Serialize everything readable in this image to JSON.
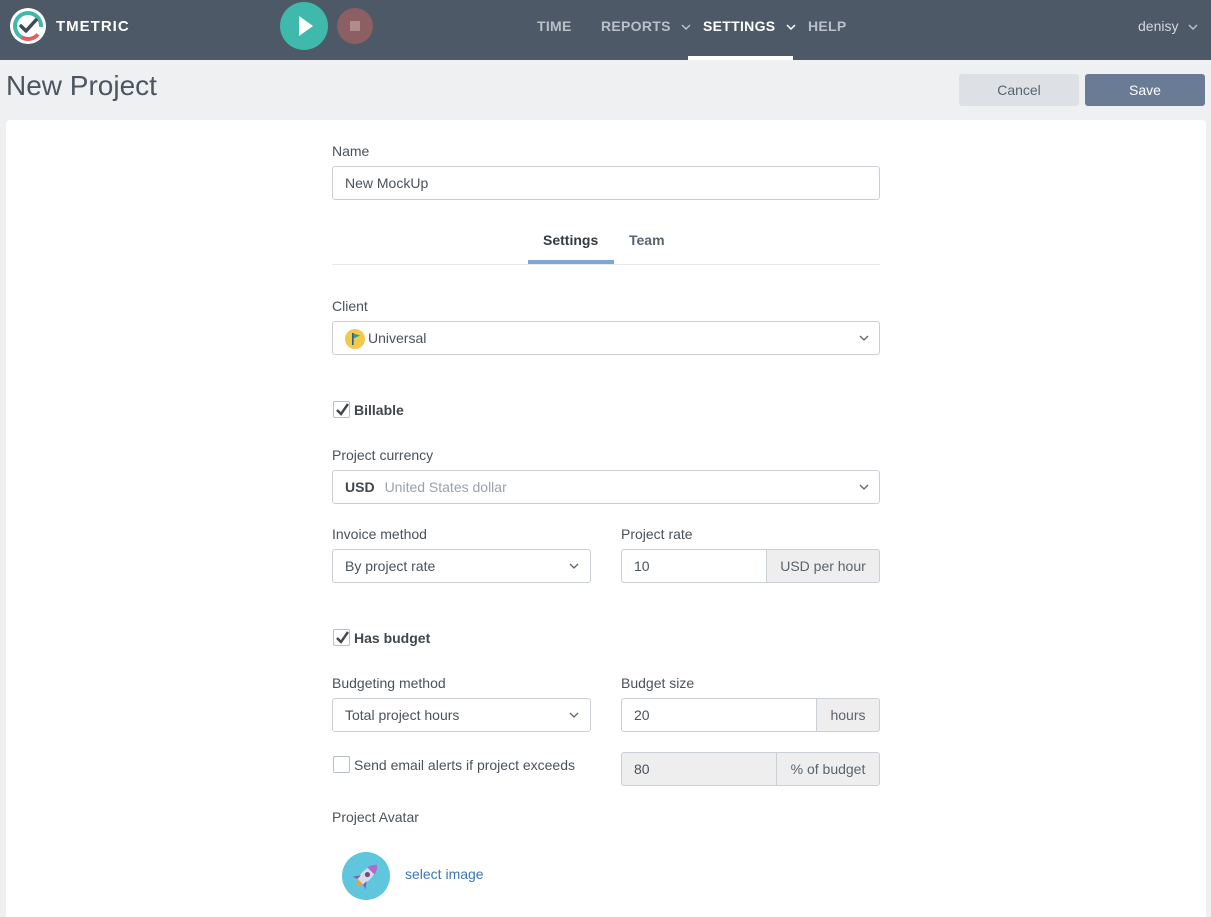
{
  "app": {
    "brand": "TMETRIC",
    "colors": {
      "topbar": "#4d5966",
      "play": "#3fb9ab",
      "stop": "#8c5f62",
      "save": "#6a7b95",
      "tab_accent": "#7ea6d8",
      "link": "#3a78b5"
    }
  },
  "nav": {
    "items": [
      {
        "label": "TIME"
      },
      {
        "label": "REPORTS"
      },
      {
        "label": "SETTINGS"
      },
      {
        "label": "HELP"
      }
    ],
    "active": "SETTINGS",
    "user": "denisy"
  },
  "header": {
    "title": "New Project",
    "cancel_label": "Cancel",
    "save_label": "Save"
  },
  "form": {
    "name": {
      "label": "Name",
      "value": "New MockUp"
    },
    "tabs": [
      {
        "label": "Settings"
      },
      {
        "label": "Team"
      }
    ],
    "active_tab": "Settings",
    "client": {
      "label": "Client",
      "value": "Universal"
    },
    "billable": {
      "label": "Billable",
      "checked": true
    },
    "currency": {
      "label": "Project currency",
      "code": "USD",
      "name": "United States dollar"
    },
    "invoice_method": {
      "label": "Invoice method",
      "value": "By project rate"
    },
    "project_rate": {
      "label": "Project rate",
      "value": "10",
      "unit": "USD per hour"
    },
    "has_budget": {
      "label": "Has budget",
      "checked": true
    },
    "budgeting_method": {
      "label": "Budgeting method",
      "value": "Total project hours"
    },
    "budget_size": {
      "label": "Budget size",
      "value": "20",
      "unit": "hours"
    },
    "email_alerts": {
      "label": "Send email alerts if project exceeds",
      "checked": false,
      "value": "80",
      "unit": "% of budget"
    },
    "avatar": {
      "label": "Project Avatar",
      "link": "select image"
    }
  }
}
